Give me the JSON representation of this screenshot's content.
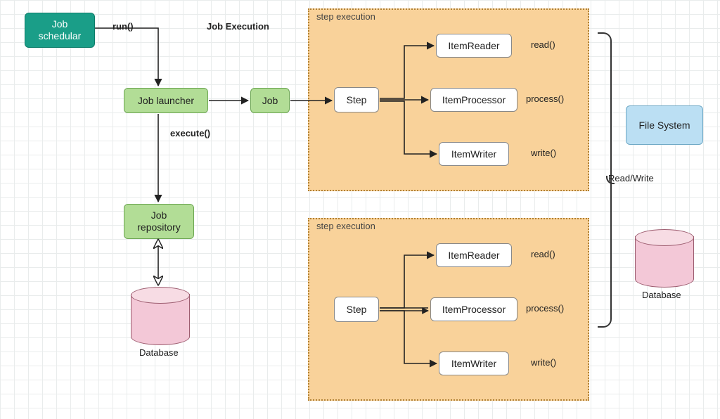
{
  "nodes": {
    "job_scheduler": "Job\nschedular",
    "job_launcher": "Job launcher",
    "job": "Job",
    "job_repository": "Job\nrepository",
    "database1": "Database",
    "step1": "Step",
    "step2": "Step",
    "item_reader": "ItemReader",
    "item_processor": "ItemProcessor",
    "item_writer": "ItemWriter",
    "file_system": "File System",
    "database2": "Database"
  },
  "labels": {
    "run": "run()",
    "job_execution": "Job Execution",
    "execute": "execute()",
    "step_execution": "step execution",
    "read": "read()",
    "process": "process()",
    "write": "write()",
    "read_write": "Read/Write"
  },
  "colors": {
    "teal": "#1a9e88",
    "green": "#b2dd96",
    "panel": "#f9d29a",
    "blue": "#bbdff3",
    "pink": "#f3c8d7"
  },
  "diagram_summary": "Spring Batch style architecture: Job scheduler -> run() -> Job launcher -> execute() -> Job -> multiple Step executions each with ItemReader(read), ItemProcessor(process), ItemWriter(write). Job launcher also talks to Job repository backed by a Database. Steps read/write to File System and external Database."
}
